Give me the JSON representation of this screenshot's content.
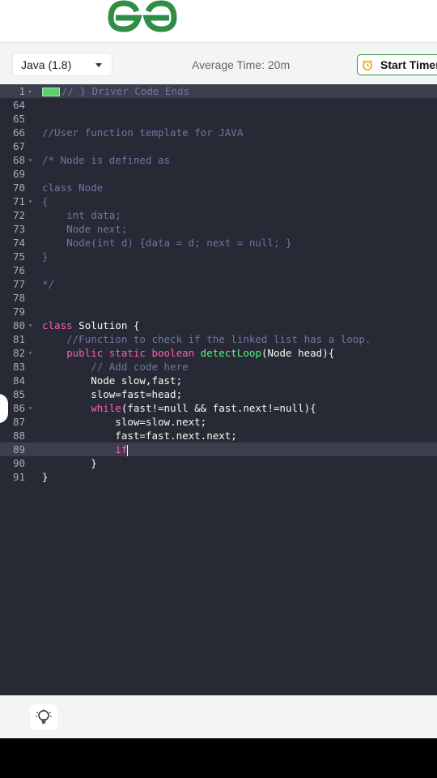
{
  "header": {
    "logo_icon": "gfg-logo-icon",
    "brand_color": "#2f8d46"
  },
  "toolbar": {
    "language": "Java (1.8)",
    "average_time": "Average Time: 20m",
    "timer_label": "Start Timer",
    "timer_icon": "alarm-clock-icon"
  },
  "editor": {
    "lines": [
      {
        "num": "1",
        "text": "// } Driver Code Ends"
      },
      {
        "num": "64",
        "text": ""
      },
      {
        "num": "65",
        "text": ""
      },
      {
        "num": "66",
        "text": "//User function template for JAVA"
      },
      {
        "num": "67",
        "text": ""
      },
      {
        "num": "68",
        "text": "/* Node is defined as"
      },
      {
        "num": "69",
        "text": ""
      },
      {
        "num": "70",
        "text": "class Node"
      },
      {
        "num": "71",
        "text": "{"
      },
      {
        "num": "72",
        "text": "    int data;"
      },
      {
        "num": "73",
        "text": "    Node next;"
      },
      {
        "num": "74",
        "text": "    Node(int d) {data = d; next = null; }"
      },
      {
        "num": "75",
        "text": "}"
      },
      {
        "num": "76",
        "text": ""
      },
      {
        "num": "77",
        "text": "*/"
      },
      {
        "num": "78",
        "text": ""
      },
      {
        "num": "79",
        "text": ""
      },
      {
        "num": "80",
        "kw": "class",
        "rest": " Solution {"
      },
      {
        "num": "81",
        "text": "    //Function to check if the linked list has a loop."
      },
      {
        "num": "82",
        "kw": "    public static boolean",
        "fn": " detectLoop",
        "rest": "(Node head){"
      },
      {
        "num": "83",
        "text": "        // Add code here"
      },
      {
        "num": "84",
        "text": "        Node slow,fast;"
      },
      {
        "num": "85",
        "text": "        slow=fast=head;"
      },
      {
        "num": "86",
        "kw": "        while",
        "rest": "(fast!=null && fast.next!=null){"
      },
      {
        "num": "87",
        "text": "            slow=slow.next;"
      },
      {
        "num": "88",
        "text": "            fast=fast.next.next;"
      },
      {
        "num": "89",
        "kw": "            if",
        "rest": ""
      },
      {
        "num": "90",
        "text": "        }"
      },
      {
        "num": "91",
        "text": "}"
      }
    ]
  },
  "footer": {
    "hint_icon": "lightbulb-icon"
  }
}
